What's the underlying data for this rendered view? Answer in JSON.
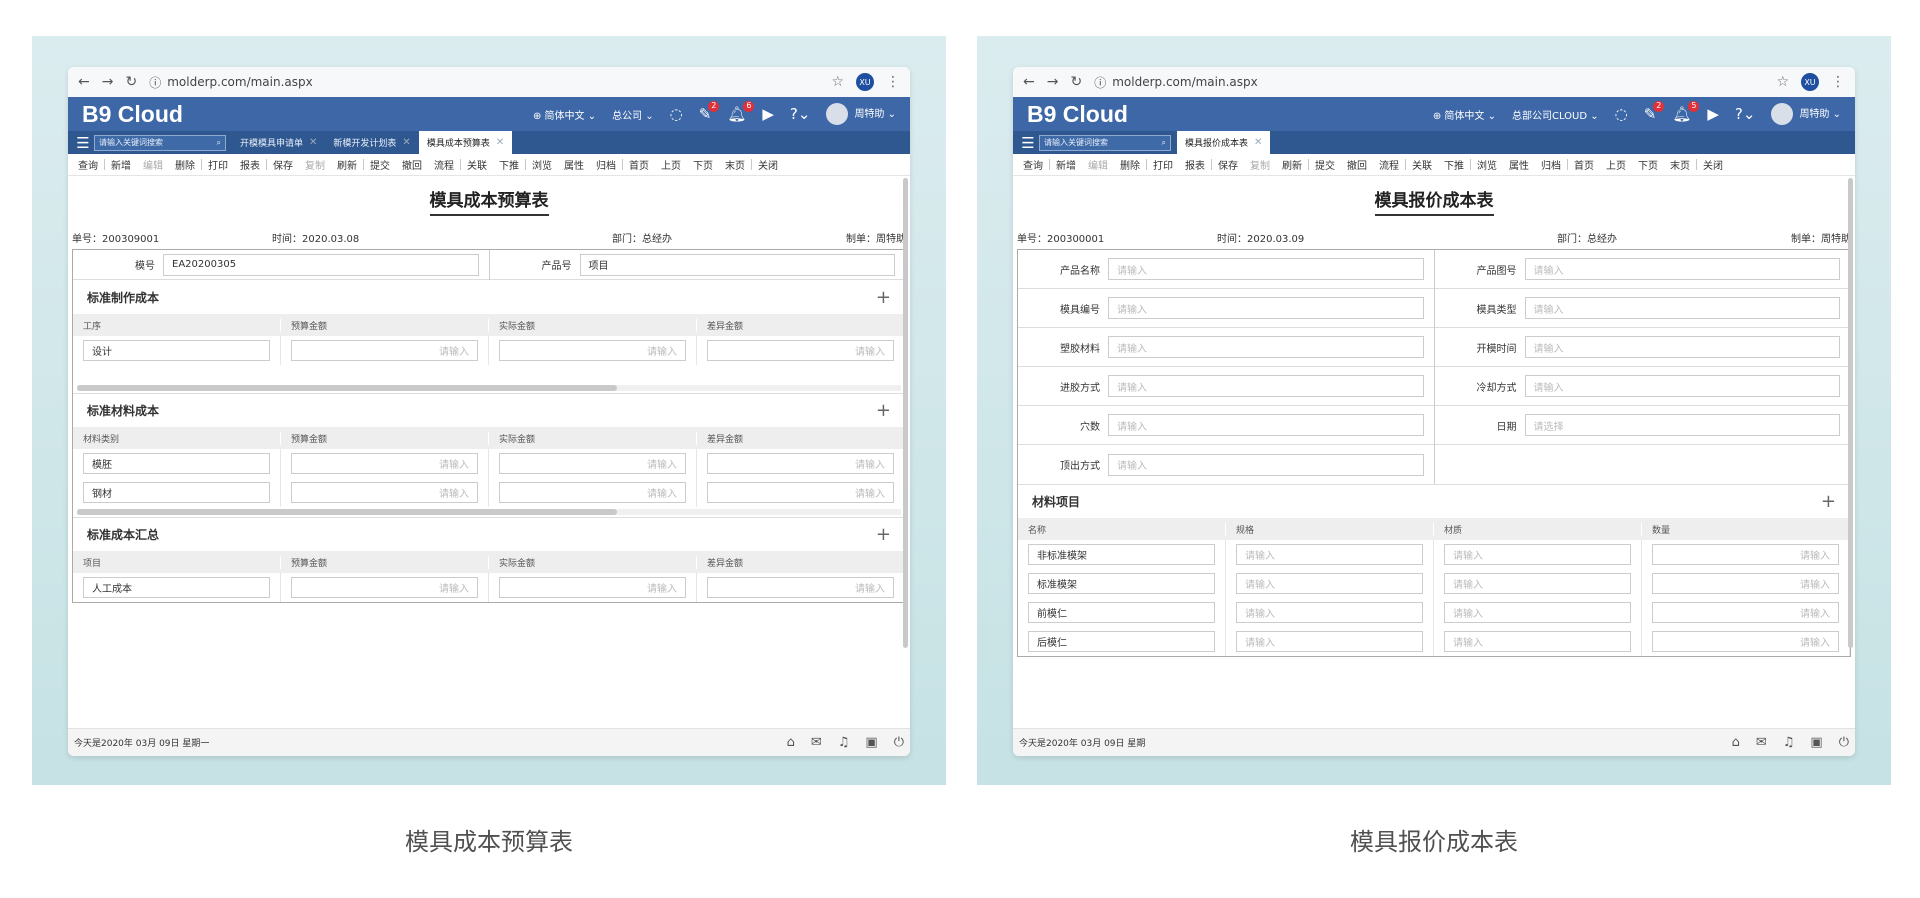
{
  "captions": {
    "left": "模具成本预算表",
    "right": "模具报价成本表"
  },
  "colors": {
    "appbar": "#3d67a6",
    "tabbar": "#2f5891",
    "badge": "#e0303a",
    "panel_bg": "#cde5e7"
  },
  "windows": {
    "left": {
      "url": "molderp.com/main.aspx",
      "profile": "XU",
      "brand": "B9 Cloud",
      "lang": "简体中文",
      "company": "总公司",
      "badge_edit": "2",
      "badge_bell": "6",
      "user": "周特助",
      "search_placeholder": "请输入关键词搜索",
      "tabs": [
        {
          "label": "开模模具申请单"
        },
        {
          "label": "新模开发计划表"
        },
        {
          "label": "模具成本预算表"
        }
      ],
      "toolbar": [
        "查询",
        "新增",
        "编辑",
        "删除",
        "打印",
        "报表",
        "保存",
        "复制",
        "刷新",
        "提交",
        "撤回",
        "流程",
        "关联",
        "下推",
        "浏览",
        "属性",
        "归档",
        "首页",
        "上页",
        "下页",
        "末页",
        "关闭"
      ],
      "title": "模具成本预算表",
      "meta": {
        "no": "单号：200309001",
        "time": "时间：2020.03.08",
        "dept": "部门：总经办",
        "maker": "制单：周特助"
      },
      "header": {
        "f1_label": "模号",
        "f1_value": "EA20200305",
        "f2_label": "产品号",
        "f2_value": "项目"
      },
      "sections": [
        {
          "title": "标准制作成本",
          "cols": [
            "工序",
            "预算金额",
            "实际金额",
            "差异金额"
          ],
          "rows": [
            [
              "设计"
            ]
          ]
        },
        {
          "title": "标准材料成本",
          "cols": [
            "材料类别",
            "预算金额",
            "实际金额",
            "差异金额"
          ],
          "rows": [
            [
              "模胚"
            ],
            [
              "钢材"
            ]
          ]
        },
        {
          "title": "标准成本汇总",
          "cols": [
            "项目",
            "预算金额",
            "实际金额",
            "差异金额"
          ],
          "rows": [
            [
              "人工成本"
            ]
          ]
        }
      ],
      "placeholder": "请输入",
      "status": "今天是2020年 03月 09日 星期一"
    },
    "right": {
      "url": "molderp.com/main.aspx",
      "profile": "XU",
      "brand": "B9 Cloud",
      "lang": "简体中文",
      "company": "总部公司CLOUD",
      "badge_edit": "2",
      "badge_bell": "5",
      "user": "周特助",
      "search_placeholder": "请输入关键词搜索",
      "tabs": [
        {
          "label": "模具报价成本表"
        }
      ],
      "toolbar": [
        "查询",
        "新增",
        "编辑",
        "删除",
        "打印",
        "报表",
        "保存",
        "复制",
        "刷新",
        "提交",
        "撤回",
        "流程",
        "关联",
        "下推",
        "浏览",
        "属性",
        "归档",
        "首页",
        "上页",
        "下页",
        "末页",
        "关闭"
      ],
      "title": "模具报价成本表",
      "meta": {
        "no": "单号：200300001",
        "time": "时间：2020.03.09",
        "dept": "部门：总经办",
        "maker": "制单：周特助"
      },
      "fields": [
        [
          "产品名称",
          "产品图号"
        ],
        [
          "模具编号",
          "模具类型"
        ],
        [
          "塑胶材料",
          "开模时间"
        ],
        [
          "进胶方式",
          "冷却方式"
        ],
        [
          "穴数",
          "日期"
        ],
        [
          "顶出方式"
        ]
      ],
      "date_placeholder": "请选择",
      "placeholder": "请输入",
      "section": {
        "title": "材料项目",
        "cols": [
          "名称",
          "规格",
          "材质",
          "数量"
        ],
        "rows": [
          [
            "非标准模架"
          ],
          [
            "标准模架"
          ],
          [
            "前模仁"
          ],
          [
            "后模仁"
          ]
        ]
      },
      "status": "今天是2020年 03月 09日 星期"
    }
  }
}
